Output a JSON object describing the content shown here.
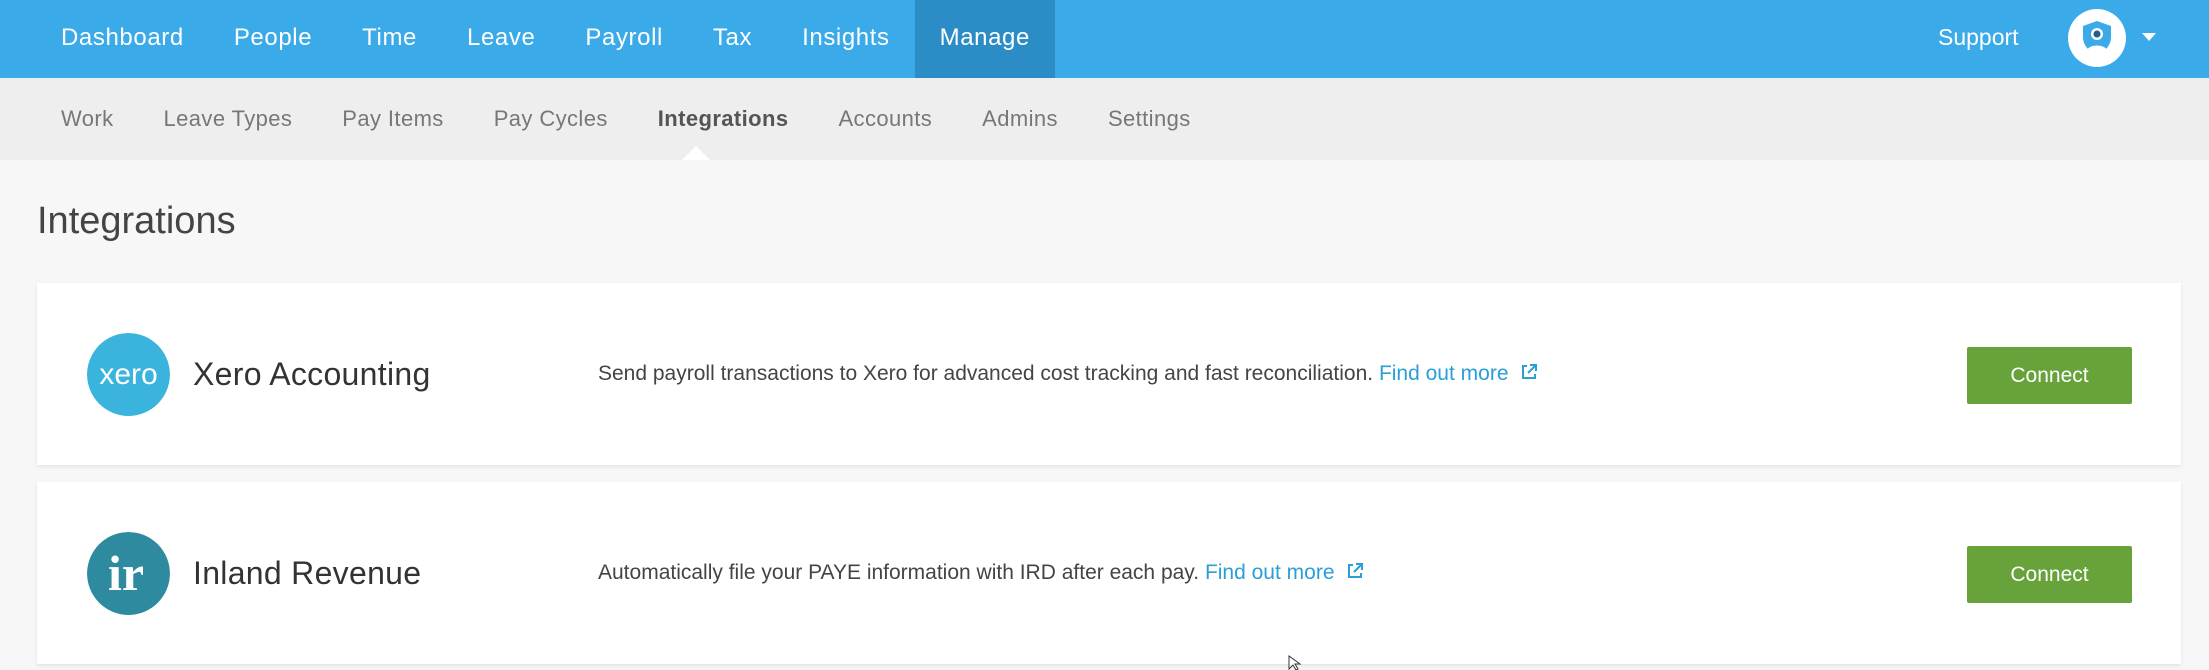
{
  "topnav": {
    "items": [
      {
        "label": "Dashboard"
      },
      {
        "label": "People"
      },
      {
        "label": "Time"
      },
      {
        "label": "Leave"
      },
      {
        "label": "Payroll"
      },
      {
        "label": "Tax"
      },
      {
        "label": "Insights"
      },
      {
        "label": "Manage",
        "active": true
      }
    ],
    "support_label": "Support",
    "avatar_icon": "user-shield-icon",
    "menu_icon": "caret-down-icon"
  },
  "subnav": {
    "items": [
      {
        "label": "Work"
      },
      {
        "label": "Leave Types"
      },
      {
        "label": "Pay Items"
      },
      {
        "label": "Pay Cycles"
      },
      {
        "label": "Integrations",
        "active": true
      },
      {
        "label": "Accounts"
      },
      {
        "label": "Admins"
      },
      {
        "label": "Settings"
      }
    ]
  },
  "page": {
    "title": "Integrations"
  },
  "integrations": [
    {
      "name": "Xero Accounting",
      "logo_text": "xero",
      "description": "Send payroll transactions to Xero for advanced cost tracking and fast reconciliation.",
      "link_label": "Find out more",
      "button_label": "Connect",
      "logo_color": "#3ab4dc"
    },
    {
      "name": "Inland Revenue",
      "logo_text": "ir",
      "description": "Automatically file your PAYE information with IRD after each pay.",
      "link_label": "Find out more",
      "button_label": "Connect",
      "logo_color": "#2e8a9e"
    }
  ],
  "colors": {
    "topbar": "#3aaae8",
    "topbar_active": "#2c8cc6",
    "link": "#2a9fd6",
    "connect_button": "#67a23b"
  }
}
